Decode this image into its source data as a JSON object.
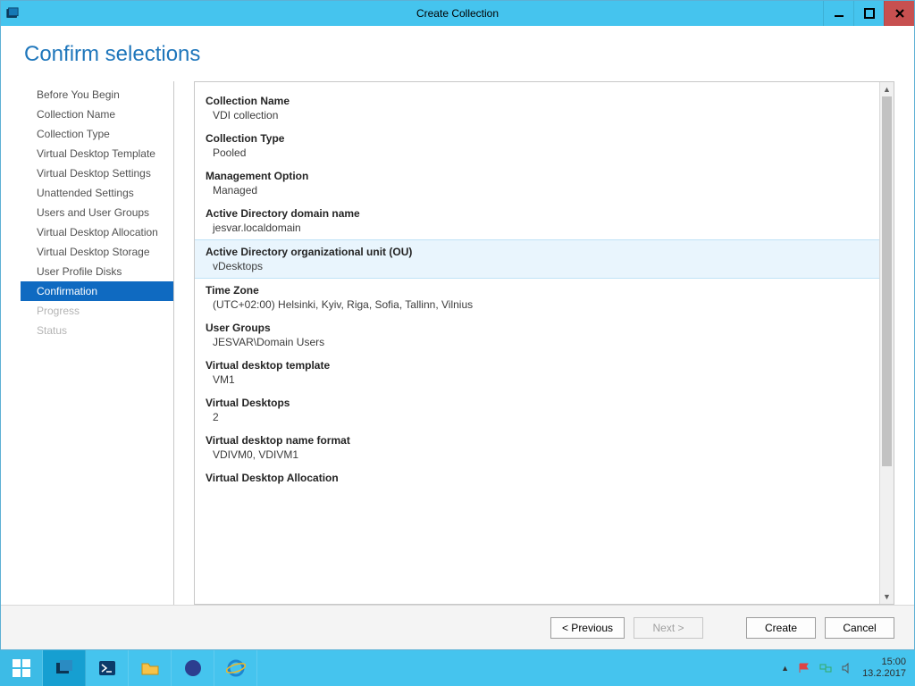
{
  "window": {
    "title": "Create Collection"
  },
  "header": {
    "title": "Confirm selections"
  },
  "nav_items": [
    {
      "label": "Before You Begin",
      "state": "normal"
    },
    {
      "label": "Collection Name",
      "state": "normal"
    },
    {
      "label": "Collection Type",
      "state": "normal"
    },
    {
      "label": "Virtual Desktop Template",
      "state": "normal"
    },
    {
      "label": "Virtual Desktop Settings",
      "state": "normal"
    },
    {
      "label": "Unattended Settings",
      "state": "normal"
    },
    {
      "label": "Users and User Groups",
      "state": "normal"
    },
    {
      "label": "Virtual Desktop Allocation",
      "state": "normal"
    },
    {
      "label": "Virtual Desktop Storage",
      "state": "normal"
    },
    {
      "label": "User Profile Disks",
      "state": "normal"
    },
    {
      "label": "Confirmation",
      "state": "selected"
    },
    {
      "label": "Progress",
      "state": "disabled"
    },
    {
      "label": "Status",
      "state": "disabled"
    }
  ],
  "confirm": [
    {
      "label": "Collection Name",
      "value": "VDI collection",
      "highlight": false
    },
    {
      "label": "Collection Type",
      "value": "Pooled",
      "highlight": false
    },
    {
      "label": "Management Option",
      "value": "Managed",
      "highlight": false
    },
    {
      "label": "Active Directory domain name",
      "value": "jesvar.localdomain",
      "highlight": false
    },
    {
      "label": "Active Directory organizational unit (OU)",
      "value": "vDesktops",
      "highlight": true
    },
    {
      "label": "Time Zone",
      "value": "(UTC+02:00) Helsinki, Kyiv, Riga, Sofia, Tallinn, Vilnius",
      "highlight": false
    },
    {
      "label": "User Groups",
      "value": "JESVAR\\Domain Users",
      "highlight": false
    },
    {
      "label": "Virtual desktop template",
      "value": "VM1",
      "highlight": false
    },
    {
      "label": "Virtual Desktops",
      "value": "2",
      "highlight": false
    },
    {
      "label": "Virtual desktop name format",
      "value": "VDIVM0, VDIVM1",
      "highlight": false
    },
    {
      "label": "Virtual Desktop Allocation",
      "value": "",
      "highlight": false,
      "label_only": true
    }
  ],
  "footer": {
    "previous": "< Previous",
    "next": "Next >",
    "create": "Create",
    "cancel": "Cancel"
  },
  "taskbar": {
    "time": "15:00",
    "date": "13.2.2017"
  }
}
